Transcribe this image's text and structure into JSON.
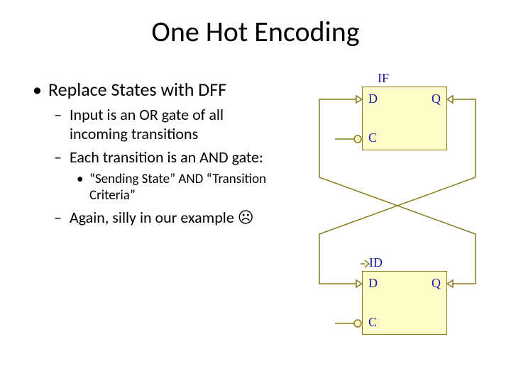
{
  "title": "One Hot Encoding",
  "bullets": {
    "main": "Replace States with DFF",
    "sub1": "Input is an OR gate of all incoming transitions",
    "sub2": "Each transition is an AND gate:",
    "sub2a": "“Sending State” AND “Transition Criteria”",
    "sub3": "Again, silly in our example ☹"
  },
  "diagram": {
    "top_label": "IF",
    "bottom_label": "ID",
    "d": "D",
    "q": "Q",
    "c": "C"
  }
}
